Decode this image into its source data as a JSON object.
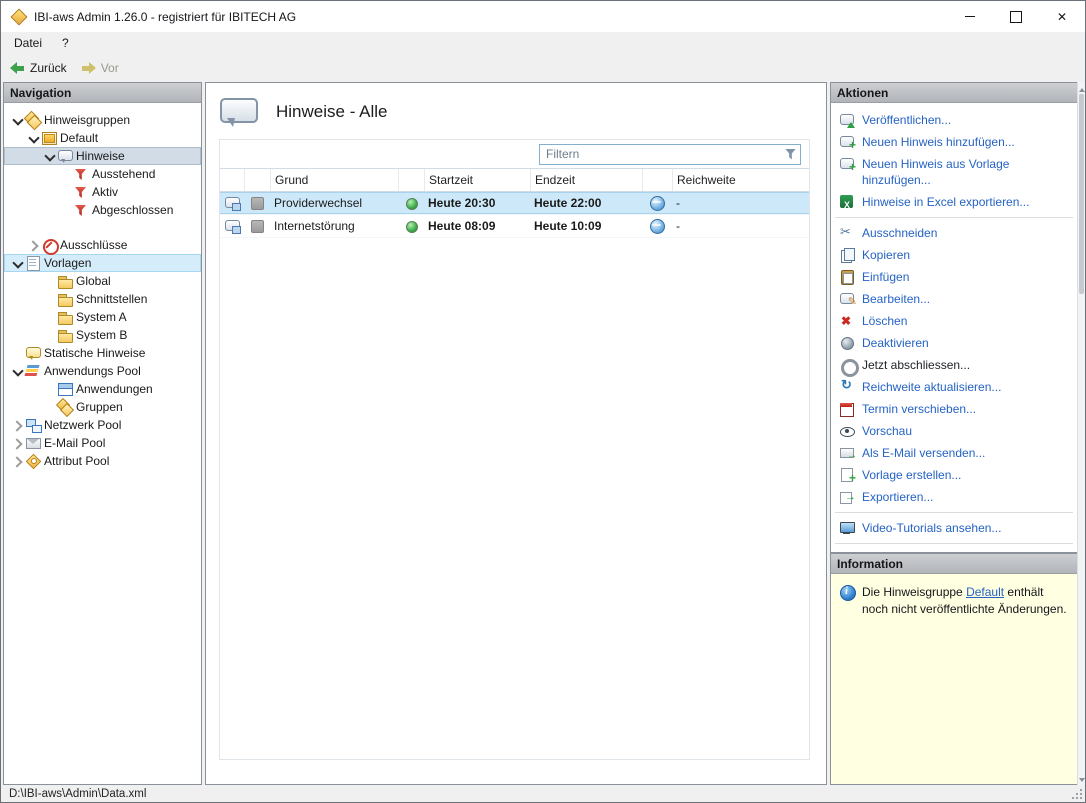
{
  "window": {
    "title": "IBI-aws Admin 1.26.0 - registriert für IBITECH AG",
    "controls": [
      "minimize",
      "maximize",
      "close"
    ],
    "status_bar": "D:\\IBI-aws\\Admin\\Data.xml"
  },
  "menubar": {
    "items": [
      "Datei",
      "?"
    ]
  },
  "toolbar": {
    "back": "Zurück",
    "forward": "Vor"
  },
  "navigation": {
    "title": "Navigation",
    "tree": [
      {
        "label": "Hinweisgruppen",
        "level": 0,
        "expander": "down",
        "icon": "hint-groups"
      },
      {
        "label": "Default",
        "level": 1,
        "expander": "down",
        "icon": "hint-group"
      },
      {
        "label": "Hinweise",
        "level": 2,
        "expander": "down",
        "icon": "speech",
        "selected": true
      },
      {
        "label": "Ausstehend",
        "level": 3,
        "expander": "none",
        "icon": "filter"
      },
      {
        "label": "Aktiv",
        "level": 3,
        "expander": "none",
        "icon": "filter"
      },
      {
        "label": "Abgeschlossen",
        "level": 3,
        "expander": "none",
        "icon": "filter"
      },
      {
        "label": "Ausschlüsse",
        "level": 1,
        "expander": "right",
        "icon": "exclusion",
        "gap": true
      },
      {
        "label": "Vorlagen",
        "level": 0,
        "expander": "down",
        "icon": "template",
        "highlight": true
      },
      {
        "label": "Global",
        "level": 2,
        "expander": "none",
        "icon": "folder"
      },
      {
        "label": "Schnittstellen",
        "level": 2,
        "expander": "none",
        "icon": "folder"
      },
      {
        "label": "System A",
        "level": 2,
        "expander": "none",
        "icon": "folder"
      },
      {
        "label": "System B",
        "level": 2,
        "expander": "none",
        "icon": "folder"
      },
      {
        "label": "Statische Hinweise",
        "level": 0,
        "expander": "none",
        "icon": "speech-static"
      },
      {
        "label": "Anwendungs Pool",
        "level": 0,
        "expander": "down",
        "icon": "pool"
      },
      {
        "label": "Anwendungen",
        "level": 2,
        "expander": "none",
        "icon": "app-window"
      },
      {
        "label": "Gruppen",
        "level": 2,
        "expander": "none",
        "icon": "groups"
      },
      {
        "label": "Netzwerk Pool",
        "level": 0,
        "expander": "right",
        "icon": "network"
      },
      {
        "label": "E-Mail Pool",
        "level": 0,
        "expander": "right",
        "icon": "mail"
      },
      {
        "label": "Attribut Pool",
        "level": 0,
        "expander": "right",
        "icon": "tag"
      }
    ]
  },
  "main": {
    "title": "Hinweise - Alle",
    "filter_placeholder": "Filtern",
    "table": {
      "columns": [
        "",
        "",
        "Grund",
        "",
        "Startzeit",
        "Endzeit",
        "",
        "Reichweite"
      ],
      "rows": [
        {
          "grund": "Providerwechsel",
          "startzeit": "Heute 20:30",
          "endzeit": "Heute 22:00",
          "reichweite": "-",
          "selected": true
        },
        {
          "grund": "Internetstörung",
          "startzeit": "Heute 08:09",
          "endzeit": "Heute 10:09",
          "reichweite": "-",
          "selected": false
        }
      ]
    }
  },
  "actions": {
    "title": "Aktionen",
    "overflow": "...",
    "items": [
      {
        "label": "Veröffentlichen...",
        "icon": "publish"
      },
      {
        "label": "Neuen Hinweis hinzufügen...",
        "icon": "add-hint"
      },
      {
        "label": "Neuen Hinweis aus Vorlage hinzufügen...",
        "icon": "add-hint-template"
      },
      {
        "label": "Hinweise in Excel exportieren...",
        "icon": "excel"
      },
      {
        "separator": true
      },
      {
        "label": "Ausschneiden",
        "icon": "cut"
      },
      {
        "label": "Kopieren",
        "icon": "copy"
      },
      {
        "label": "Einfügen",
        "icon": "paste"
      },
      {
        "label": "Bearbeiten...",
        "icon": "edit"
      },
      {
        "label": "Löschen",
        "icon": "delete"
      },
      {
        "label": "Deaktivieren",
        "icon": "deactivate"
      },
      {
        "label": "Jetzt abschliessen...",
        "icon": "finish",
        "disabled": true
      },
      {
        "label": "Reichweite aktualisieren...",
        "icon": "refresh"
      },
      {
        "label": "Termin verschieben...",
        "icon": "reschedule"
      },
      {
        "label": "Vorschau",
        "icon": "preview"
      },
      {
        "label": "Als E-Mail versenden...",
        "icon": "send-email"
      },
      {
        "label": "Vorlage erstellen...",
        "icon": "create-template"
      },
      {
        "label": "Exportieren...",
        "icon": "export"
      },
      {
        "separator": true
      },
      {
        "label": "Video-Tutorials ansehen...",
        "icon": "video"
      }
    ]
  },
  "information": {
    "title": "Information",
    "text_before": "Die Hinweisgruppe ",
    "link": "Default",
    "text_after": " enthält noch nicht veröffentlichte Änderungen."
  }
}
